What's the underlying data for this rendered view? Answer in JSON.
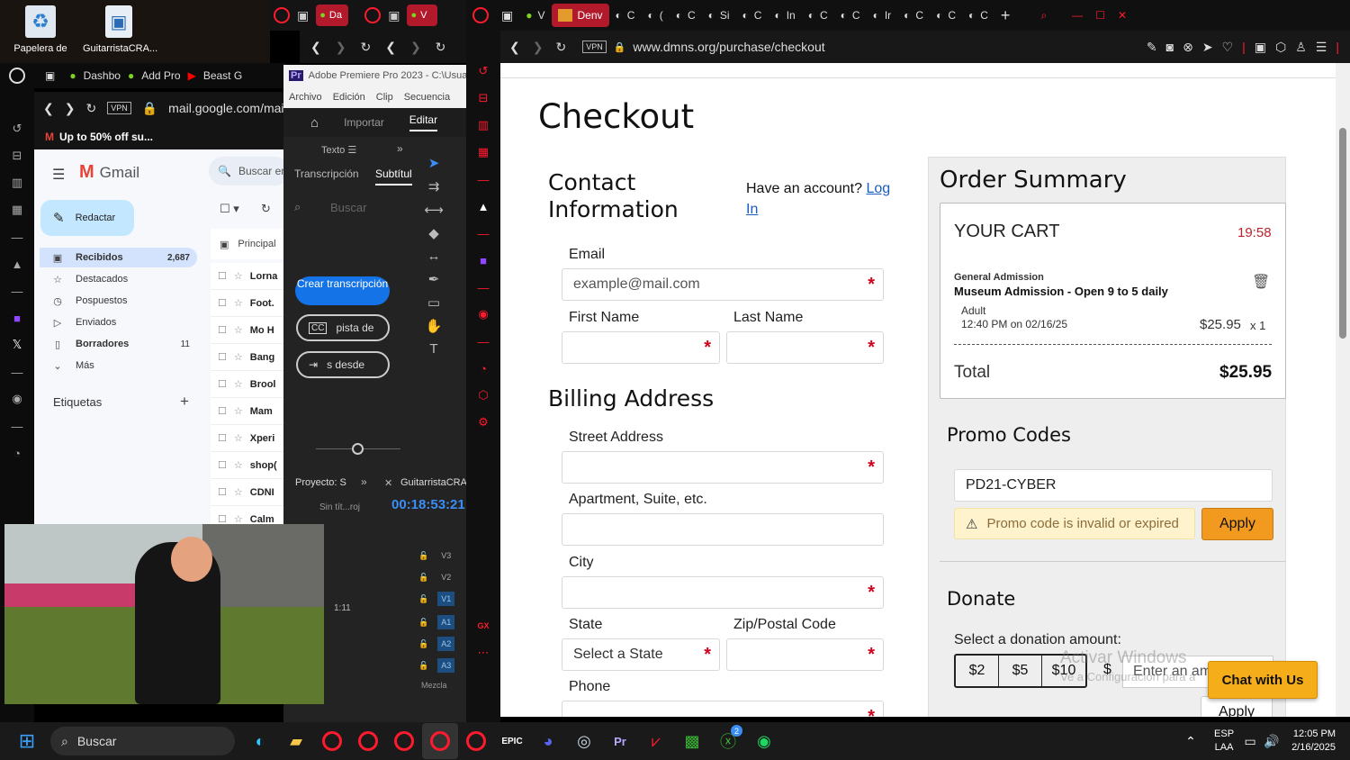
{
  "desktop": {
    "icons": [
      {
        "label": "Papelera de"
      },
      {
        "label": "GuitarristaCRA..."
      }
    ]
  },
  "gmail_window": {
    "tabs": [
      "Dashbo",
      "Add Pro",
      "Beast G"
    ],
    "url": "mail.google.com/mail/u",
    "bookmark": "Up to 50% off su...",
    "brand": "Gmail",
    "search_placeholder": "Buscar en",
    "compose": "Redactar",
    "nav": [
      {
        "label": "Recibidos",
        "count": "2,687"
      },
      {
        "label": "Destacados",
        "count": ""
      },
      {
        "label": "Pospuestos",
        "count": ""
      },
      {
        "label": "Enviados",
        "count": ""
      },
      {
        "label": "Borradores",
        "count": "11"
      },
      {
        "label": "Más",
        "count": ""
      }
    ],
    "labels_heading": "Etiquetas",
    "tab_principal": "Principal",
    "senders": [
      "Lorna",
      "Foot.",
      "Mo H",
      "Bang",
      "Brool",
      "Mam",
      "Xperi",
      "shop(",
      "CDNI",
      "Calm"
    ]
  },
  "premiere": {
    "title": "Adobe Premiere Pro 2023 - C:\\Usua",
    "menu": [
      "Archivo",
      "Edición",
      "Clip",
      "Secuencia"
    ],
    "header_tabs": [
      "Importar",
      "Editar"
    ],
    "panel_tab": "Texto",
    "sub_tabs": [
      "Transcripción",
      "Subtítul"
    ],
    "search_placeholder": "Buscar",
    "btn_create": "Crear transcripción",
    "btn_track": "pista de",
    "btn_from": "s desde",
    "project_tab": "Proyecto: S",
    "project_item": "Sin tít...roj",
    "seq_tab": "GuitarristaCRAZ",
    "timecode": "00:18:53:21",
    "thumb_dur": "1:11",
    "tracks": [
      "V3",
      "V2",
      "V1",
      "A1",
      "A2",
      "A3"
    ],
    "track_extra": "Mezcla"
  },
  "browser": {
    "tabs": [
      {
        "label": "Denv"
      },
      {
        "label": "C"
      },
      {
        "label": "("
      },
      {
        "label": "C"
      },
      {
        "label": "Si"
      },
      {
        "label": "C"
      },
      {
        "label": "In"
      },
      {
        "label": "C"
      },
      {
        "label": "C"
      },
      {
        "label": "Ir"
      },
      {
        "label": "C"
      },
      {
        "label": "C"
      },
      {
        "label": "C"
      }
    ],
    "first_tab": "V",
    "vpn": "VPN",
    "url": "www.dmns.org/purchase/checkout"
  },
  "checkout": {
    "title": "Checkout",
    "contact_heading": "Contact Information",
    "account_prompt": "Have an account?",
    "login": "Log In",
    "email_label": "Email",
    "email_placeholder": "example@mail.com",
    "first_name_label": "First Name",
    "last_name_label": "Last Name",
    "billing_heading": "Billing Address",
    "street_label": "Street Address",
    "apt_label": "Apartment, Suite, etc.",
    "city_label": "City",
    "state_label": "State",
    "state_value": "Select a State",
    "zip_label": "Zip/Postal Code",
    "phone_label": "Phone"
  },
  "summary": {
    "heading": "Order Summary",
    "cart_heading": "YOUR CART",
    "timer": "19:58",
    "item_category": "General Admission",
    "item_name": "Museum Admission - Open 9 to 5 daily",
    "ticket_type": "Adult",
    "ticket_time": "12:40 PM on 02/16/25",
    "ticket_price": "$25.95",
    "ticket_qty": "x 1",
    "total_label": "Total",
    "total_value": "$25.95",
    "promo_heading": "Promo Codes",
    "promo_value": "PD21-CYBER",
    "promo_error": "Promo code is invalid or expired",
    "apply": "Apply",
    "donate_heading": "Donate",
    "donate_prompt": "Select a donation amount:",
    "amounts": [
      "$2",
      "$5",
      "$10"
    ],
    "dollar": "$",
    "custom_placeholder": "Enter an amo",
    "donate_apply": "Apply",
    "chat": "Chat with Us"
  },
  "watermark": {
    "line1": "Activar Windows",
    "line2": "Ve a Configuración para a"
  },
  "taskbar": {
    "search": "Buscar",
    "lang1": "ESP",
    "lang2": "LAA",
    "time": "12:05 PM",
    "date": "2/16/2025",
    "badge": "2"
  },
  "colors": {
    "accent_red": "#ff1b2d",
    "apply_orange": "#f29a1f",
    "promo_warn_bg": "#fff3cd",
    "gmail_compose": "#c2e7ff",
    "timer_red": "#c0202a",
    "link_blue": "#1a5cc0"
  }
}
